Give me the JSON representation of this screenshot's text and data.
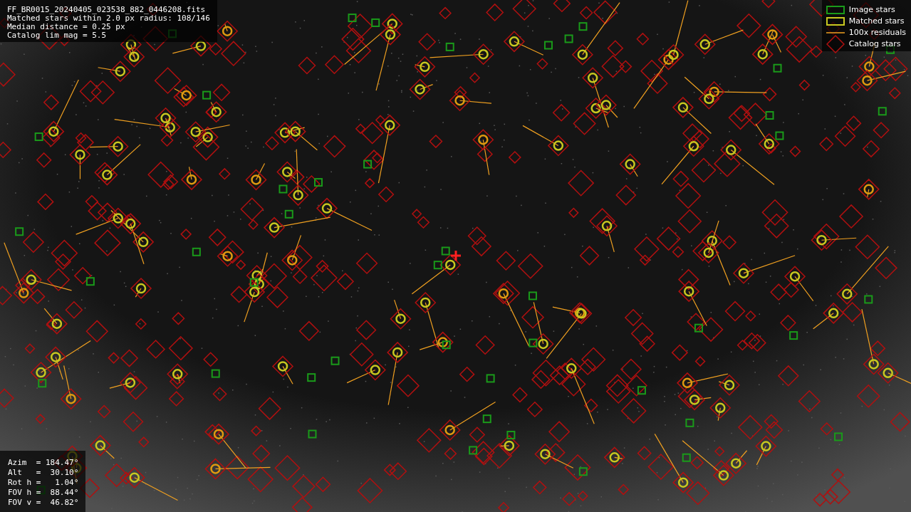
{
  "image_info": [
    "FF_BR0015_20240405_023538_882_0446208.fits",
    "Matched stars within 2.0 px radius: 108/146",
    "Median distance = 0.25 px",
    "Catalog lim mag = 5.5"
  ],
  "legend": [
    {
      "kind": "image",
      "label": "Image stars"
    },
    {
      "kind": "matched",
      "label": "Matched stars"
    },
    {
      "kind": "residual",
      "label": "100x residuals"
    },
    {
      "kind": "catalog",
      "label": "Catalog stars"
    }
  ],
  "pointing": [
    "Azim  = 184.47°",
    "Alt   =  30.10°",
    "Rot h =   1.04°",
    "FOV h =  88.44°",
    "FOV v =  46.82°"
  ]
}
